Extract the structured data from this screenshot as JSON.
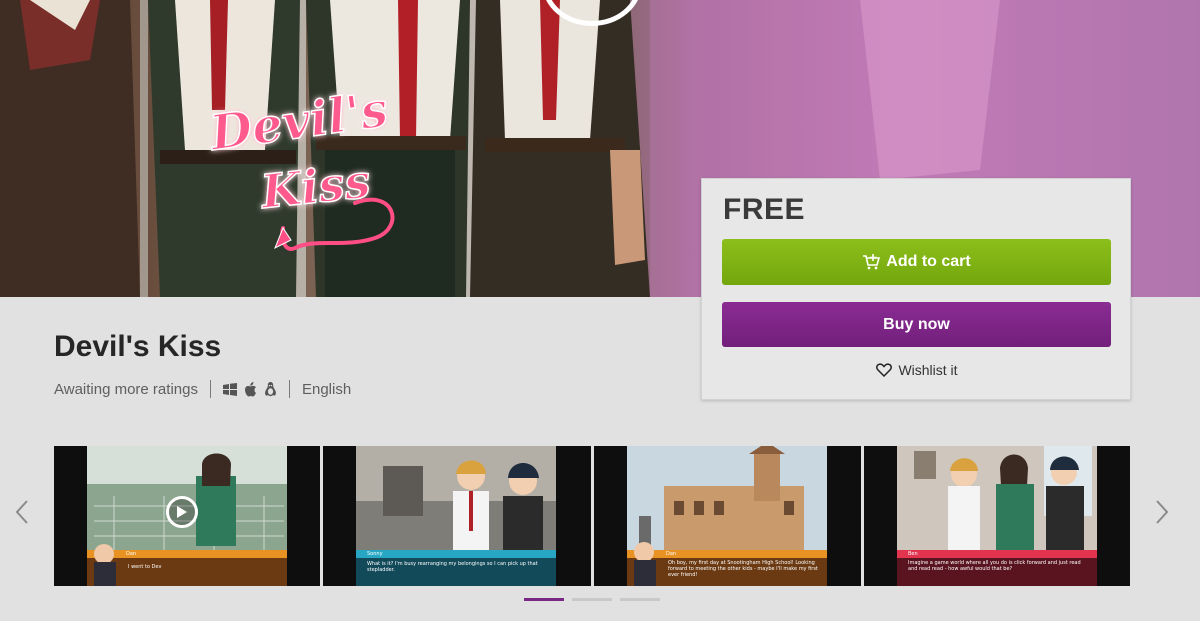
{
  "hero": {
    "logo_text_line1": "Devil's",
    "logo_text_line2": "Kiss"
  },
  "purchase": {
    "price": "FREE",
    "add_to_cart_label": "Add to cart",
    "buy_now_label": "Buy now",
    "wishlist_label": "Wishlist it",
    "colors": {
      "add_to_cart": "#7fb115",
      "buy_now": "#7e2587"
    }
  },
  "product": {
    "title": "Devil's Kiss",
    "rating_text": "Awaiting more ratings",
    "platform_icons": [
      "windows-icon",
      "apple-icon",
      "linux-icon"
    ],
    "language": "English"
  },
  "screenshots": [
    {
      "speaker": "Dan",
      "caption": "I went to Dev",
      "is_video": true
    },
    {
      "speaker": "Sonny",
      "caption": "What is it? I'm busy rearranging my belongings so I can pick up that stepladder."
    },
    {
      "speaker": "Dan",
      "caption": "Oh boy, my first day at Snootingham High School! Looking forward to meeting the other kids - maybe I'll make my first ever friend!"
    },
    {
      "speaker": "Ben",
      "caption": "Imagine a game world where all you do is click forward and just read and read read - how awful would that be?"
    }
  ],
  "carousel": {
    "page_count": 3,
    "active_page": 1,
    "accent_color": "#7b2885"
  }
}
